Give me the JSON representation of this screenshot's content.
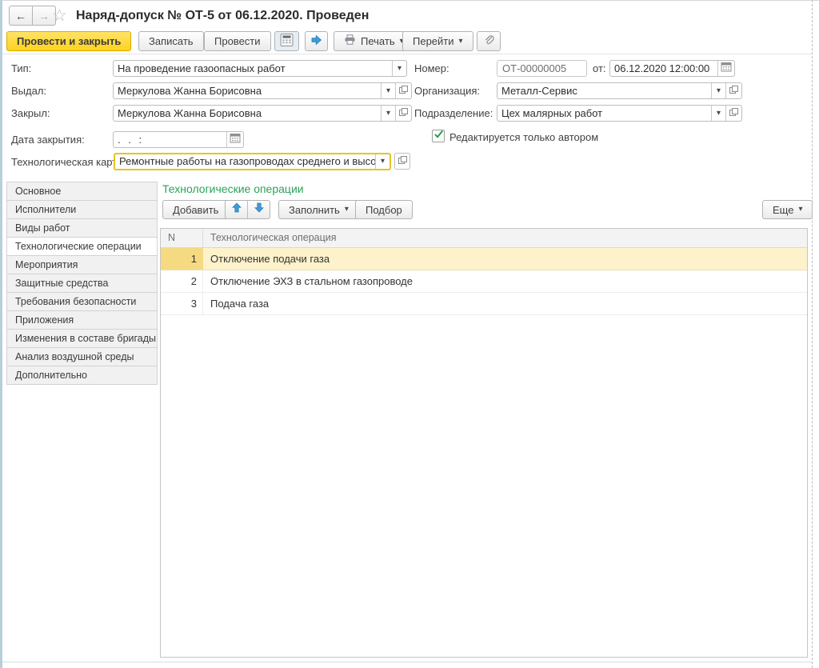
{
  "header": {
    "title": "Наряд-допуск № ОТ-5 от 06.12.2020. Проведен"
  },
  "icons": {
    "back": "←",
    "forward": "→",
    "favorite": "☆",
    "dropdown": "▾",
    "printer": "printer-glyph-svg",
    "paperclip": "paperclip-glyph-svg",
    "calculator": "calculator-glyph-svg",
    "post_arrow": "blue-right-arrow-svg",
    "calendar": "calendar-glyph-svg",
    "open": "open-record-svg",
    "move_up": "blue-up-arrow-svg",
    "move_down": "blue-down-arrow-svg",
    "check": "green-check-svg"
  },
  "toolbar": {
    "post_and_close": "Провести и закрыть",
    "write": "Записать",
    "post": "Провести",
    "print": "Печать",
    "navigate": "Перейти"
  },
  "form": {
    "type": {
      "label": "Тип:",
      "value": "На проведение газоопасных работ"
    },
    "issued_by": {
      "label": "Выдал:",
      "value": "Меркулова Жанна Борисовна"
    },
    "closed_by": {
      "label": "Закрыл:",
      "value": "Меркулова Жанна Борисовна"
    },
    "close_date": {
      "label": "Дата закрытия:",
      "value": ".  .     :"
    },
    "tech_card": {
      "label": "Технологическая карта:",
      "value": "Ремонтные работы на газопроводах среднего и высокого да"
    },
    "number": {
      "label": "Номер:",
      "value": "ОТ-00000005"
    },
    "date": {
      "label": "от:",
      "value": "06.12.2020 12:00:00"
    },
    "organization": {
      "label": "Организация:",
      "value": "Металл-Сервис"
    },
    "department": {
      "label": "Подразделение:",
      "value": "Цех малярных работ"
    },
    "author_only": {
      "label": "Редактируется только автором",
      "checked": true
    }
  },
  "sidebar": {
    "items": [
      {
        "label": "Основное",
        "active": false
      },
      {
        "label": "Исполнители",
        "active": false
      },
      {
        "label": "Виды работ",
        "active": false
      },
      {
        "label": "Технологические операции",
        "active": true
      },
      {
        "label": "Мероприятия",
        "active": false
      },
      {
        "label": "Защитные средства",
        "active": false
      },
      {
        "label": "Требования безопасности",
        "active": false
      },
      {
        "label": "Приложения",
        "active": false
      },
      {
        "label": "Изменения в составе бригады",
        "active": false
      },
      {
        "label": "Анализ воздушной среды",
        "active": false
      },
      {
        "label": "Дополнительно",
        "active": false
      }
    ]
  },
  "operations": {
    "title": "Технологические операции",
    "add": "Добавить",
    "fill": "Заполнить",
    "pick": "Подбор",
    "more": "Еще",
    "table": {
      "columns": {
        "n": "N",
        "operation": "Технологическая операция"
      },
      "rows": [
        {
          "n": "1",
          "operation": "Отключение подачи газа",
          "selected": true
        },
        {
          "n": "2",
          "operation": "Отключение ЭХЗ в стальном газопроводе",
          "selected": false
        },
        {
          "n": "3",
          "operation": "Подача газа",
          "selected": false
        }
      ]
    }
  },
  "colors": {
    "primary_button": "#ffd21e",
    "selected_row": "#fdf2cb",
    "selected_row_number_cell": "#f5da82",
    "section_title_green": "#2ca05a",
    "focus_border_yellow": "#e9c227",
    "move_arrow_blue": "#3f9cd6"
  }
}
